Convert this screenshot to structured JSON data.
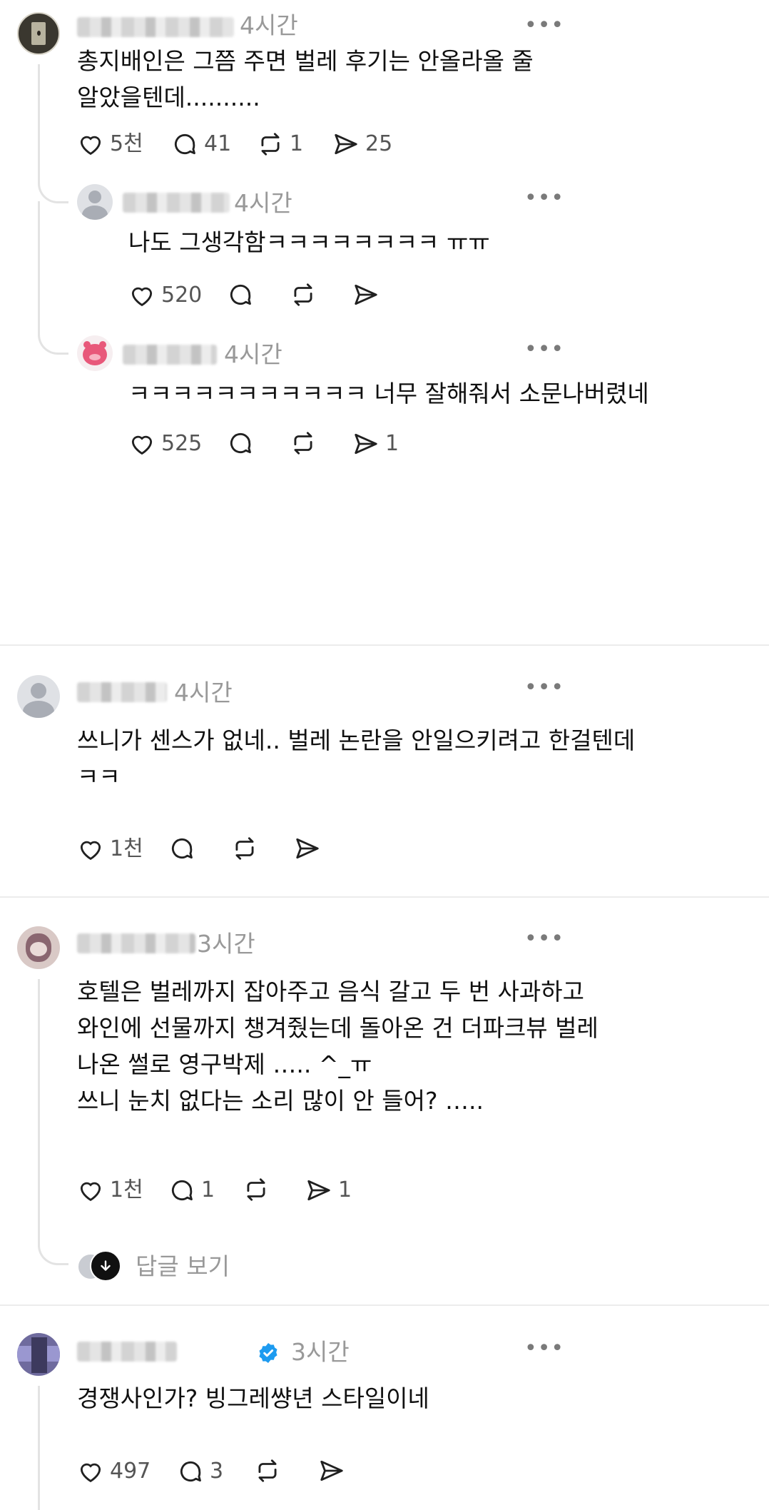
{
  "posts": [
    {
      "time": "4시간",
      "text": [
        "총지배인은 그쯤 주면 벌레 후기는 안올라올 줄",
        "알았을텐데.........."
      ],
      "likes": "5천",
      "comments": "41",
      "reposts": "1",
      "shares": "25"
    },
    {
      "time": "4시간",
      "text": [
        "나도 그생각함ㅋㅋㅋㅋㅋㅋㅋㅋ ㅠㅠ"
      ],
      "likes": "520",
      "comments": "",
      "reposts": "",
      "shares": ""
    },
    {
      "time": "4시간",
      "text": [
        "ㅋㅋㅋㅋㅋㅋㅋㅋㅋㅋㅋ 너무 잘해줘서 소문나버렸네"
      ],
      "likes": "525",
      "comments": "",
      "reposts": "",
      "shares": "1"
    },
    {
      "time": "4시간",
      "text": [
        "쓰니가 센스가 없네.. 벌레 논란을 안일으키려고 한걸텐데",
        "ㅋㅋ"
      ],
      "likes": "1천",
      "comments": "",
      "reposts": "",
      "shares": ""
    },
    {
      "time": "3시간",
      "text": [
        "호텔은 벌레까지 잡아주고 음식 갈고 두 번 사과하고",
        "와인에 선물까지 챙겨줬는데 돌아온 건 더파크뷰 벌레",
        "나온 썰로 영구박제 ….. ^_ㅠ",
        "쓰니 눈치 없다는 소리 많이 안 들어? ….."
      ],
      "likes": "1천",
      "comments": "1",
      "reposts": "",
      "shares": "1"
    },
    {
      "time": "3시간",
      "text": [
        "경쟁사인가? 빙그레썅년 스타일이네"
      ],
      "likes": "497",
      "comments": "3",
      "reposts": "",
      "shares": ""
    }
  ],
  "view_replies_label": "답글 보기",
  "more_label": "•••",
  "colors": {
    "verified": "#1d9bf0",
    "muted": "#999999"
  }
}
